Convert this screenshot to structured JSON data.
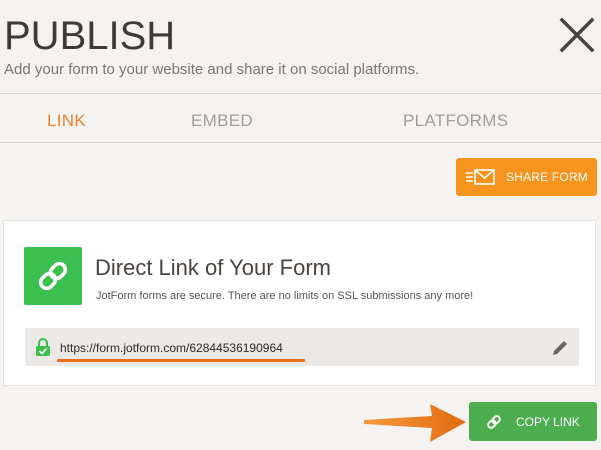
{
  "header": {
    "title": "PUBLISH",
    "subtitle": "Add your form to your website and share it on social platforms."
  },
  "tabs": [
    {
      "label": "LINK",
      "active": true
    },
    {
      "label": "EMBED",
      "active": false
    },
    {
      "label": "PLATFORMS",
      "active": false
    }
  ],
  "share_button": {
    "label": "SHARE FORM",
    "icon": "envelope-icon"
  },
  "card": {
    "title": "Direct Link of Your Form",
    "description": "JotForm forms are secure. There are no limits on SSL submissions any more!",
    "icon": "link-icon",
    "url": "https://form.jotform.com/62844536190964"
  },
  "copy_button": {
    "label": "COPY LINK",
    "icon": "link-icon"
  },
  "colors": {
    "accent_orange": "#f7941d",
    "active_tab": "#f0802a",
    "green": "#4dae4f",
    "link_badge": "#3bbf4f",
    "background": "#f4f3f1"
  }
}
